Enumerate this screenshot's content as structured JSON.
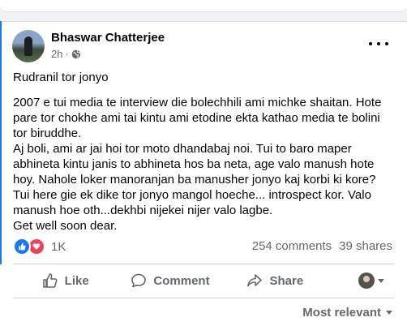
{
  "post": {
    "author": "Bhaswar Chatterjee",
    "time": "2h",
    "separator": "·",
    "paragraphs": [
      "Rudranil tor jonyo",
      "2007 e tui media te interview die bolechhili ami michke shaitan. Hote pare tor chokhe ami tai kintu ami etodine ekta  kathao media te bolini tor biruddhe.\nAj boli, ami ar jai hoi tor moto dhandabaj noi. Tui to baro maper abhineta kintu janis to abhineta hos ba neta, age valo manush hote hoy. Nahole loker manoranjan ba manusher jonyo kaj korbi ki kore?\nTui here gie ek dike tor jonyo mangol hoeche... introspect kor. Valo manush hoe oth...dekhbi nijekei nijer valo lagbe.\nGet well soon dear."
    ]
  },
  "engagement": {
    "reaction_count": "1K",
    "comments": "254 comments",
    "shares": "39 shares"
  },
  "actions": {
    "like": "Like",
    "comment": "Comment",
    "share": "Share"
  },
  "sort": {
    "label": "Most relevant"
  },
  "colors": {
    "like_blue": "#1877f2",
    "love_red": "#f33e58",
    "muted_text": "#65676b"
  },
  "icons": [
    "globe-icon",
    "more-options-icon",
    "like-reaction-icon",
    "love-reaction-icon",
    "thumbs-up-icon",
    "comment-bubble-icon",
    "share-arrow-icon",
    "chevron-down-icon"
  ]
}
